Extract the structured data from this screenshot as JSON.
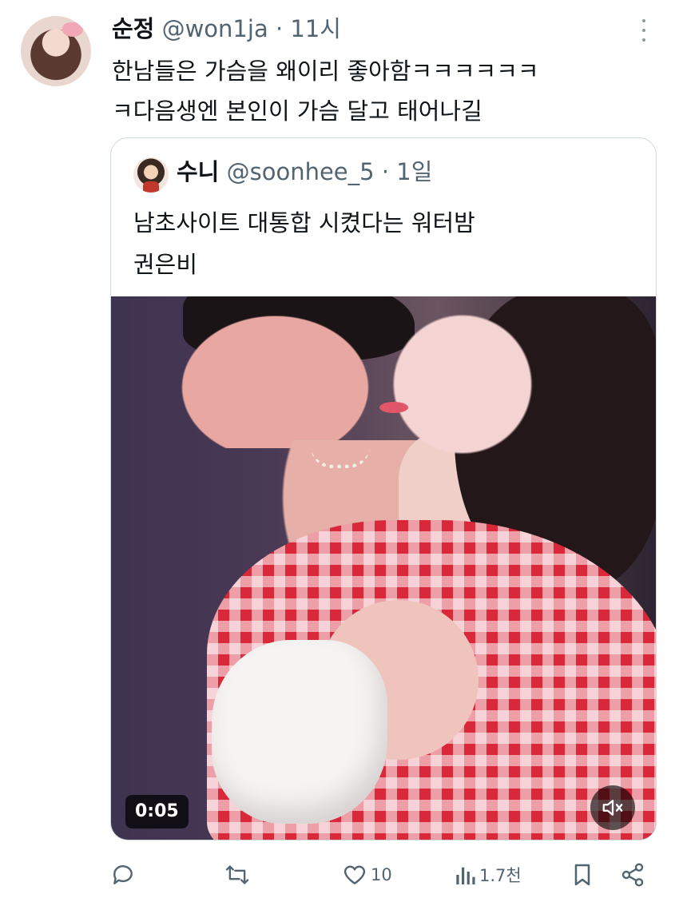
{
  "tweet": {
    "display_name": "순정",
    "handle": "@won1ja",
    "separator": "·",
    "time": "11시",
    "text": "한남들은 가슴을 왜이리 좋아함ㅋㅋㅋㅋㅋㅋ\nㅋ다음생엔 본인이 가슴 달고 태어나길"
  },
  "quote": {
    "display_name": "수니",
    "handle": "@soonhee_5",
    "separator": "·",
    "time": "1일",
    "text": "남초사이트 대통합 시켰다는 워터밤\n권은비",
    "video": {
      "timestamp": "0:05",
      "muted": true
    }
  },
  "actions": {
    "reply_count": "",
    "retweet_count": "",
    "like_count": "10",
    "views_count": "1.7천"
  },
  "icons": {
    "more": "more-vertical-icon",
    "reply": "reply-icon",
    "retweet": "retweet-icon",
    "like": "heart-icon",
    "views": "views-chart-icon",
    "bookmark": "bookmark-icon",
    "share": "share-icon",
    "mute": "speaker-muted-icon"
  },
  "colors": {
    "text": "#0f1419",
    "secondary": "#536471",
    "border": "#cfd9de"
  }
}
